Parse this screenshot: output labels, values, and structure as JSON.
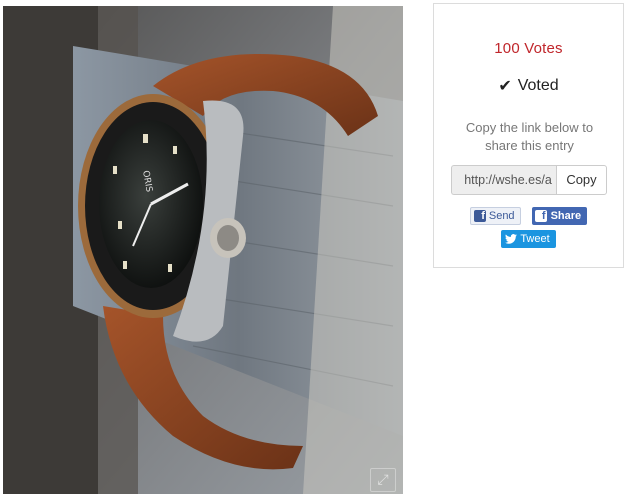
{
  "photo": {
    "alt_icons": [
      "watch-photo",
      "expand-icon"
    ]
  },
  "panel": {
    "votes_label": "100 Votes",
    "voted_label": "Voted",
    "copy_instructions": "Copy the link below to share this entry",
    "link_value": "http://wshe.es/a",
    "copy_label": "Copy",
    "fb_send_label": "Send",
    "fb_share_label": "Share",
    "tweet_label": "Tweet"
  },
  "colors": {
    "votes": "#c0262b",
    "facebook": "#4267b2",
    "twitter": "#1b95e0"
  }
}
